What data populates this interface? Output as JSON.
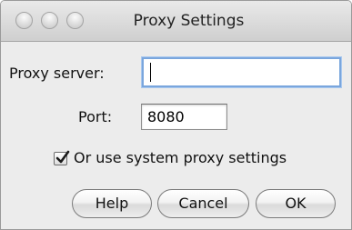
{
  "window": {
    "title": "Proxy Settings"
  },
  "form": {
    "proxy_server_label": "Proxy server:",
    "proxy_server_value": "",
    "port_label": "Port:",
    "port_value": "8080",
    "system_proxy_label": "Or use system proxy settings",
    "system_proxy_checked": true
  },
  "buttons": {
    "help": "Help",
    "cancel": "Cancel",
    "ok": "OK"
  },
  "colors": {
    "focus_ring": "#7aa6dd",
    "window_bg": "#ececec"
  }
}
